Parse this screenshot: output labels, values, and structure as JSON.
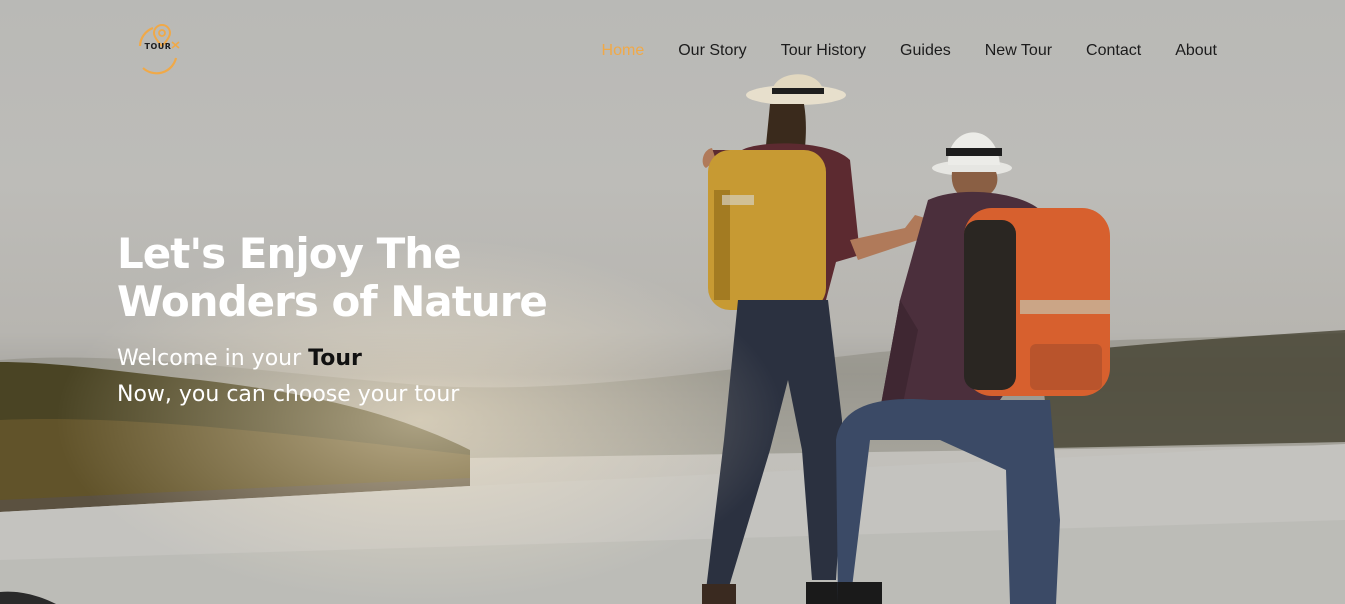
{
  "logo": {
    "text": "TOUR",
    "icon": "map-pin-icon",
    "accent": "#f0a948"
  },
  "nav": {
    "items": [
      {
        "label": "Home",
        "active": true
      },
      {
        "label": "Our Story"
      },
      {
        "label": "Tour History"
      },
      {
        "label": "Guides"
      },
      {
        "label": "New Tour"
      },
      {
        "label": "Contact"
      },
      {
        "label": "About"
      }
    ]
  },
  "hero": {
    "headline_line1": "Let's Enjoy The",
    "headline_line2": "Wonders of Nature",
    "welcome_prefix": "Welcome in your",
    "welcome_brand": "Tour",
    "subtitle": "Now, you can choose your tour",
    "background": "hikers-lake-photo"
  },
  "colors": {
    "accent": "#f0a948",
    "text_light": "#ffffff",
    "nav_text": "#1c1c1c"
  }
}
